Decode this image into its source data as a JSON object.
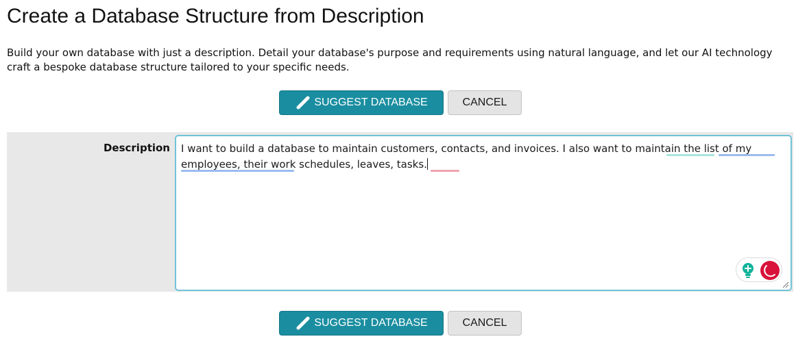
{
  "page": {
    "title": "Create a Database Structure from Description",
    "intro": "Build your own database with just a description. Detail your database's purpose and requirements using natural language, and let our AI technology craft a bespoke database structure tailored to your specific needs."
  },
  "actions": {
    "suggest_label": "SUGGEST DATABASE",
    "suggest_icon": "pencil-icon",
    "cancel_label": "CANCEL"
  },
  "form": {
    "description_label": "Description",
    "description_value": "I want to build a database to maintain customers, contacts, and invoices. I also want to maintain the list of my employees, their work schedules, leaves, tasks."
  },
  "colors": {
    "primary_button": "#1a8ea0",
    "secondary_button": "#e4e4e4",
    "textarea_focus_border": "#6fc3d6",
    "panel_background": "#e8e8e8",
    "grammar_underline_teal": "#a6e6dc",
    "grammar_underline_blue": "#9bbcf0",
    "spelling_underline_red": "#f0a3ae"
  },
  "writing_assistant": {
    "suggestion_icon": "lightbulb-icon",
    "status_icon": "writing-assistant-icon"
  }
}
